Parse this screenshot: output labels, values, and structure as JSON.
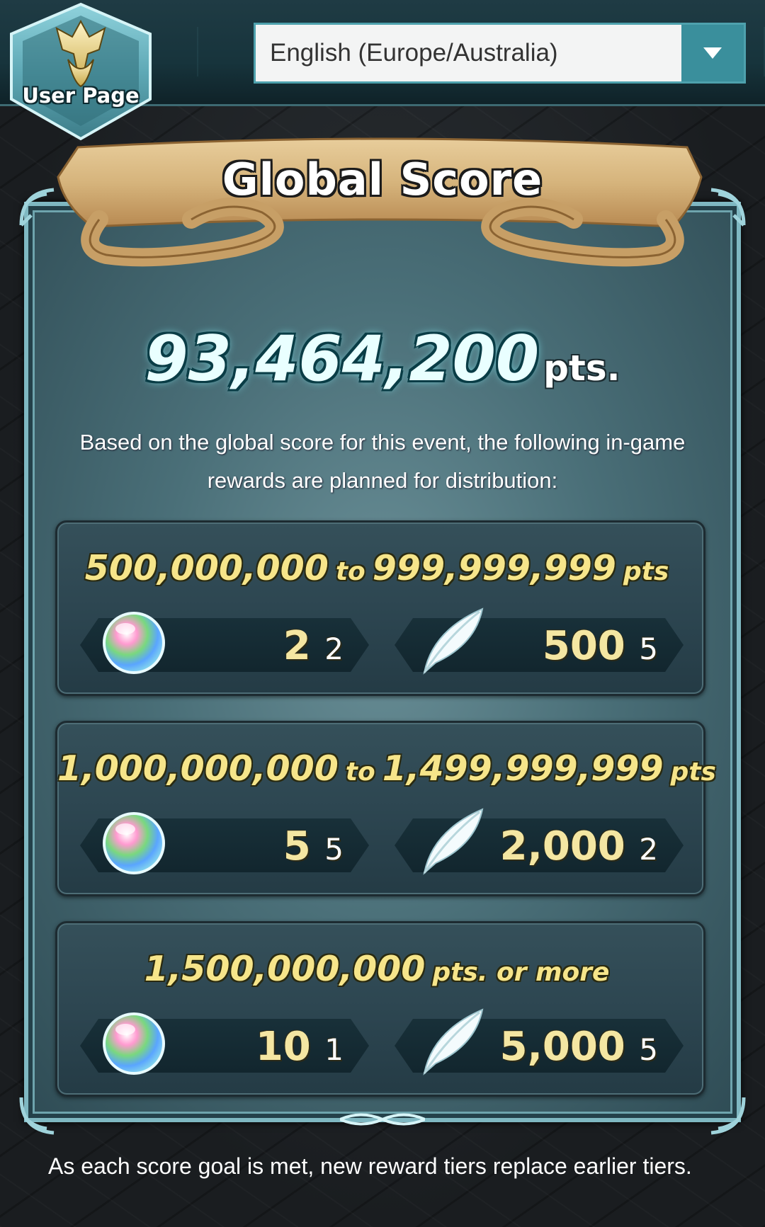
{
  "header": {
    "user_page_label": "User Page",
    "language": {
      "selected": "English (Europe/Australia)"
    }
  },
  "panel": {
    "title": "Global Score",
    "score": {
      "value": "93,464,200",
      "unit": "pts."
    },
    "description": "Based on the global score for this event, the following in-game rewards are planned for distribution:",
    "tiers": [
      {
        "range_from": "500,000,000",
        "connector": "to",
        "range_to": "999,999,999",
        "unit": "pts",
        "orbs": "2",
        "orbs_clipped": "2",
        "feathers": "500",
        "feathers_clipped": "5"
      },
      {
        "range_from": "1,000,000,000",
        "connector": "to",
        "range_to": "1,499,999,999",
        "unit": "pts",
        "orbs": "5",
        "orbs_clipped": "5",
        "feathers": "2,000",
        "feathers_clipped": "2"
      },
      {
        "range_from": "1,500,000,000",
        "connector": "pts. or more",
        "range_to": "",
        "unit": "",
        "orbs": "10",
        "orbs_clipped": "1",
        "feathers": "5,000",
        "feathers_clipped": "5"
      }
    ]
  },
  "footer": {
    "note": "As each score goal is met, new reward tiers replace earlier tiers."
  },
  "icons": {
    "orb": "orb-icon",
    "feather": "feather-icon",
    "dropdown": "chevron-down-icon",
    "crest": "crest-icon"
  },
  "colors": {
    "accent": "#3a8f9c",
    "gold_text": "#f6e58a",
    "score_text": "#e9ffff"
  }
}
